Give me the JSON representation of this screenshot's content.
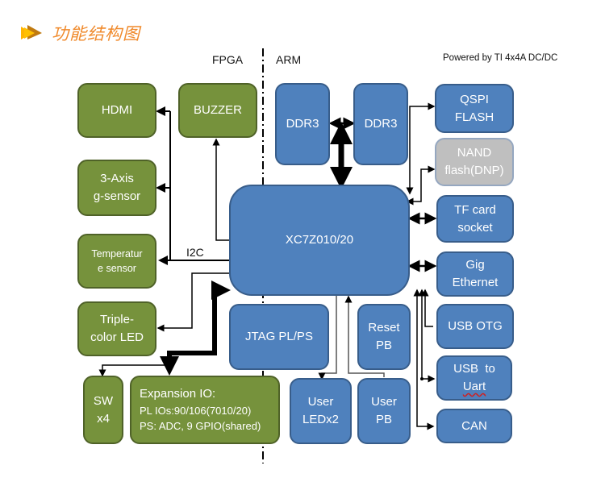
{
  "header": {
    "title": "功能结构图",
    "icon": "double-arrow-icon"
  },
  "labels": {
    "fpga": "FPGA",
    "arm": "ARM",
    "powered_by": "Powered by TI 4x4A DC/DC",
    "i2c": "I2C"
  },
  "colors": {
    "fpga_block": "#76923c",
    "arm_block": "#4f81bd",
    "dnp_block": "#bfbfbf",
    "title": "#f08a2c"
  },
  "blocks": {
    "hdmi": "HDMI",
    "buzzer": "BUZZER",
    "g_sensor": "3-Axis\ng-sensor",
    "temperature": "Temperatur\ne sensor",
    "triple_led": "Triple-\ncolor LED",
    "sw": "SW\nx4",
    "expansion": {
      "line1": "Expansion IO:",
      "line2": "PL IOs:90/106(7010/20)",
      "line3": "PS: ADC, 9 GPIO(shared)"
    },
    "ddr3_a": "DDR3",
    "ddr3_b": "DDR3",
    "soc": "XC7Z010/20",
    "jtag": "JTAG PL/PS",
    "reset_pb": "Reset\nPB",
    "user_led": "User\nLEDx2",
    "user_pb": "User\nPB",
    "qspi": "QSPI\nFLASH",
    "nand": "NAND\nflash(DNP)",
    "tf_card": "TF card\nsocket",
    "gig_eth": "Gig\nEthernet",
    "usb_otg": "USB OTG",
    "usb_uart_1": "USB  to",
    "usb_uart_2": "Uart",
    "can": "CAN"
  }
}
